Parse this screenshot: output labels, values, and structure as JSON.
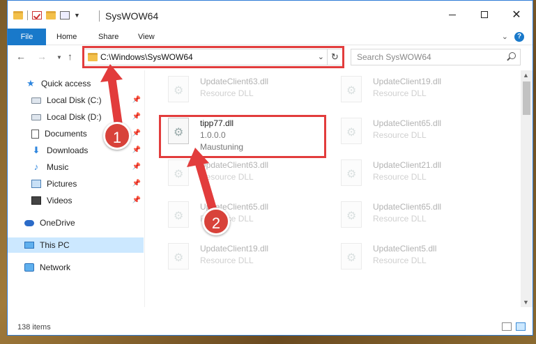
{
  "window": {
    "title": "SysWOW64",
    "controls": {
      "minimize": "minimize",
      "maximize": "maximize",
      "close": "✕"
    }
  },
  "ribbon": {
    "tabs": [
      "File",
      "Home",
      "Share",
      "View"
    ],
    "help": "?"
  },
  "nav": {
    "address": "C:\\Windows\\SysWOW64",
    "search_placeholder": "Search SysWOW64"
  },
  "sidebar": {
    "items": [
      {
        "label": "Quick access",
        "icon": "star-icon",
        "pinned": false
      },
      {
        "label": "Local Disk (C:)",
        "icon": "disk-icon",
        "pinned": true
      },
      {
        "label": "Local Disk (D:)",
        "icon": "disk-icon",
        "pinned": true
      },
      {
        "label": "Documents",
        "icon": "documents-icon",
        "pinned": true
      },
      {
        "label": "Downloads",
        "icon": "downloads-icon",
        "pinned": true
      },
      {
        "label": "Music",
        "icon": "music-icon",
        "pinned": true
      },
      {
        "label": "Pictures",
        "icon": "pictures-icon",
        "pinned": true
      },
      {
        "label": "Videos",
        "icon": "videos-icon",
        "pinned": true
      },
      {
        "label": "OneDrive",
        "icon": "onedrive-icon",
        "pinned": false
      },
      {
        "label": "This PC",
        "icon": "this-pc-icon",
        "pinned": false,
        "selected": true
      },
      {
        "label": "Network",
        "icon": "network-icon",
        "pinned": false
      }
    ]
  },
  "files": {
    "highlighted": {
      "name": "tipp77.dll",
      "version": "1.0.0.0",
      "company": "Maustuning"
    },
    "left_column": [
      {
        "name": "UpdateClient63.dll",
        "type": "Resource DLL"
      },
      {
        "name": "UpdateClient63.dll",
        "type": "Resource DLL"
      },
      {
        "name": "UpdateClient65.dll",
        "type": "Resource DLL"
      },
      {
        "name": "UpdateClient19.dll",
        "type": "Resource DLL"
      }
    ],
    "right_column": [
      {
        "name": "UpdateClient19.dll",
        "type": "Resource DLL"
      },
      {
        "name": "UpdateClient65.dll",
        "type": "Resource DLL"
      },
      {
        "name": "UpdateClient21.dll",
        "type": "Resource DLL"
      },
      {
        "name": "UpdateClient65.dll",
        "type": "Resource DLL"
      },
      {
        "name": "UpdateClient5.dll",
        "type": "Resource DLL"
      }
    ]
  },
  "status": {
    "count": "138 items"
  },
  "annotations": {
    "step1": "1",
    "step2": "2",
    "color": "#e23c3c"
  }
}
